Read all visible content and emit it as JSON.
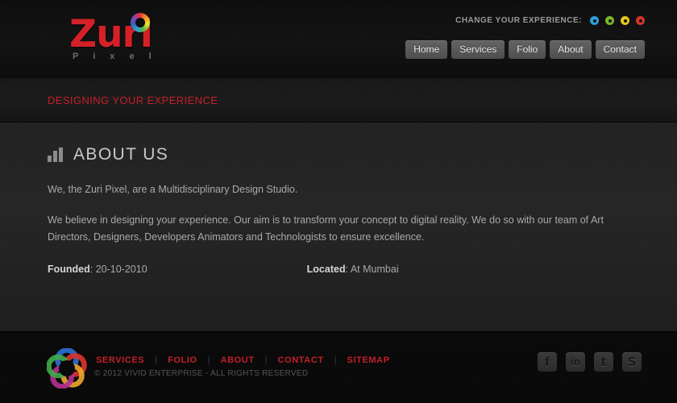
{
  "brand": {
    "name": "Zuri",
    "subname": "P i x e l",
    "mark_icon": "color-wheel-icon"
  },
  "header": {
    "experience_label": "CHANGE YOUR EXPERIENCE:",
    "swatches": [
      {
        "name": "blue",
        "color": "#2d9fd9"
      },
      {
        "name": "green",
        "color": "#7ab829"
      },
      {
        "name": "yellow",
        "color": "#e5c820"
      },
      {
        "name": "red",
        "color": "#d8352c"
      }
    ],
    "nav": [
      {
        "label": "Home"
      },
      {
        "label": "Services"
      },
      {
        "label": "Folio"
      },
      {
        "label": "About"
      },
      {
        "label": "Contact"
      }
    ]
  },
  "tagline": "DESIGNING YOUR EXPERIENCE",
  "main": {
    "section_icon": "bar-chart-icon",
    "section_title": "ABOUT US",
    "paragraph_1": "We, the Zuri Pixel, are a Multidisciplinary Design Studio.",
    "paragraph_2": "We believe in designing your experience. Our aim is to transform your concept to digital reality. We do so with our team of Art Directors, Designers, Developers Animators and Technologists to ensure excellence.",
    "founded_label": "Founded",
    "founded_value": ": 20-10-2010",
    "located_label": "Located",
    "located_value": ": At Mumbai"
  },
  "footer": {
    "logo_icon": "color-swirl-logo-icon",
    "links": [
      {
        "label": "SERVICES"
      },
      {
        "label": "FOLIO"
      },
      {
        "label": "ABOUT"
      },
      {
        "label": "CONTACT"
      },
      {
        "label": "SITEMAP"
      }
    ],
    "separator": "|",
    "copyright": "© 2012 VIVID ENTERPRISE  -  ALL RIGHTS RESERVED",
    "socials": [
      {
        "name": "facebook",
        "glyph": "f"
      },
      {
        "name": "linkedin",
        "glyph": "in"
      },
      {
        "name": "twitter",
        "glyph": "t"
      },
      {
        "name": "skype",
        "glyph": "S"
      }
    ]
  },
  "colors": {
    "accent_red": "#c41f28",
    "logo_red": "#d42027",
    "body_text": "#a9a9a9",
    "panel_bg": "#242424",
    "page_bg": "#0b0b0b"
  }
}
